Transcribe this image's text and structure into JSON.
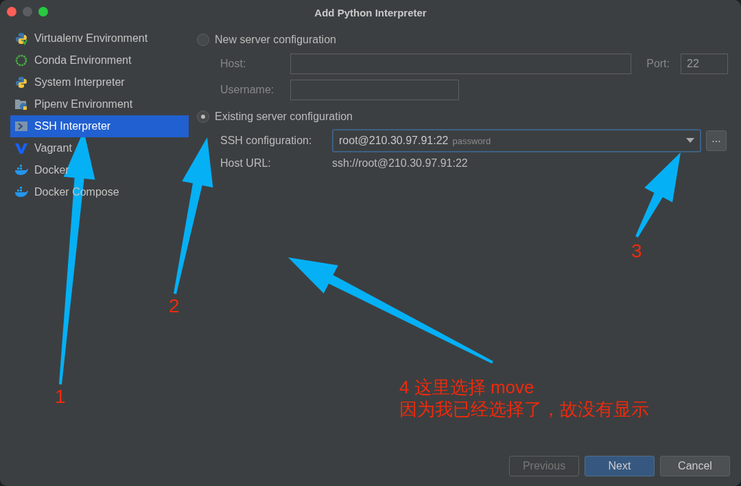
{
  "window": {
    "title": "Add Python Interpreter"
  },
  "sidebar": {
    "items": [
      {
        "label": "Virtualenv Environment",
        "selected": false
      },
      {
        "label": "Conda Environment",
        "selected": false
      },
      {
        "label": "System Interpreter",
        "selected": false
      },
      {
        "label": "Pipenv Environment",
        "selected": false
      },
      {
        "label": "SSH Interpreter",
        "selected": true
      },
      {
        "label": "Vagrant",
        "selected": false
      },
      {
        "label": "Docker",
        "selected": false
      },
      {
        "label": "Docker Compose",
        "selected": false
      }
    ]
  },
  "options": [
    {
      "label": "New server configuration",
      "selected": false,
      "fields": [
        {
          "label": "Host:"
        },
        {
          "label": "Username:"
        }
      ],
      "port": {
        "label": "Port:",
        "value": "22"
      }
    },
    {
      "label": "Existing server configuration",
      "selected": true,
      "ssh": {
        "label": "SSH configuration:",
        "value": "root@210.30.97.91:22",
        "hint": "password",
        "browse": "..."
      },
      "url": {
        "label": "Host URL:",
        "value": "ssh://root@210.30.97.91:22"
      }
    }
  ],
  "annotations": [
    {
      "label": "1"
    },
    {
      "label": "2"
    },
    {
      "label": "3"
    },
    {
      "label": "4 这里选择 move",
      "lines": [
        "因为我已经选择了，故没有显示"
      ]
    }
  ],
  "buttons": [
    {
      "label": "Previous",
      "disabled": true,
      "default": false
    },
    {
      "label": "Next",
      "disabled": false,
      "default": true
    },
    {
      "label": "Cancel",
      "disabled": false,
      "default": false
    }
  ]
}
